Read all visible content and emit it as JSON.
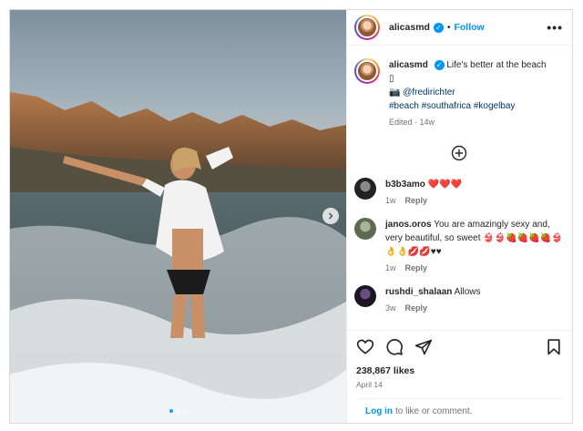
{
  "post": {
    "username": "alicasmd",
    "follow_label": "Follow",
    "separator": "•",
    "more_label": "•••"
  },
  "caption": {
    "username": "alicasmd",
    "text": "Life's better at the beach",
    "tofu": "▯",
    "camera": "📷",
    "mention": "@fredirichter",
    "hashtags": "#beach #southafrica #kogelbay",
    "meta": "Edited · 14w"
  },
  "comments": [
    {
      "username": "b3b3amo",
      "text": "❤️❤️❤️",
      "time": "1w",
      "reply": "Reply"
    },
    {
      "username": "janos.oros",
      "text": "You are amazingly sexy and, very beautiful, so sweet 👙👙🍓🍓🍓🍓👙👌👌💋💋♥♥",
      "time": "1w",
      "reply": "Reply"
    },
    {
      "username": "rushdi_shalaan",
      "text": "Allows",
      "time": "3w",
      "reply": "Reply"
    }
  ],
  "engagement": {
    "likes": "238,867 likes",
    "date": "April 14"
  },
  "login": {
    "link": "Log in",
    "suffix": "to like or comment."
  },
  "colors": {
    "accent": "#0095f6",
    "text": "#262626",
    "muted": "#737373"
  },
  "icons": {
    "heart": "heart-icon",
    "comment": "comment-icon",
    "share": "share-icon",
    "save": "bookmark-icon",
    "add": "plus-circle-icon",
    "next": "chevron-right-icon"
  },
  "carousel": {
    "slides": 3,
    "active_index": 0
  }
}
